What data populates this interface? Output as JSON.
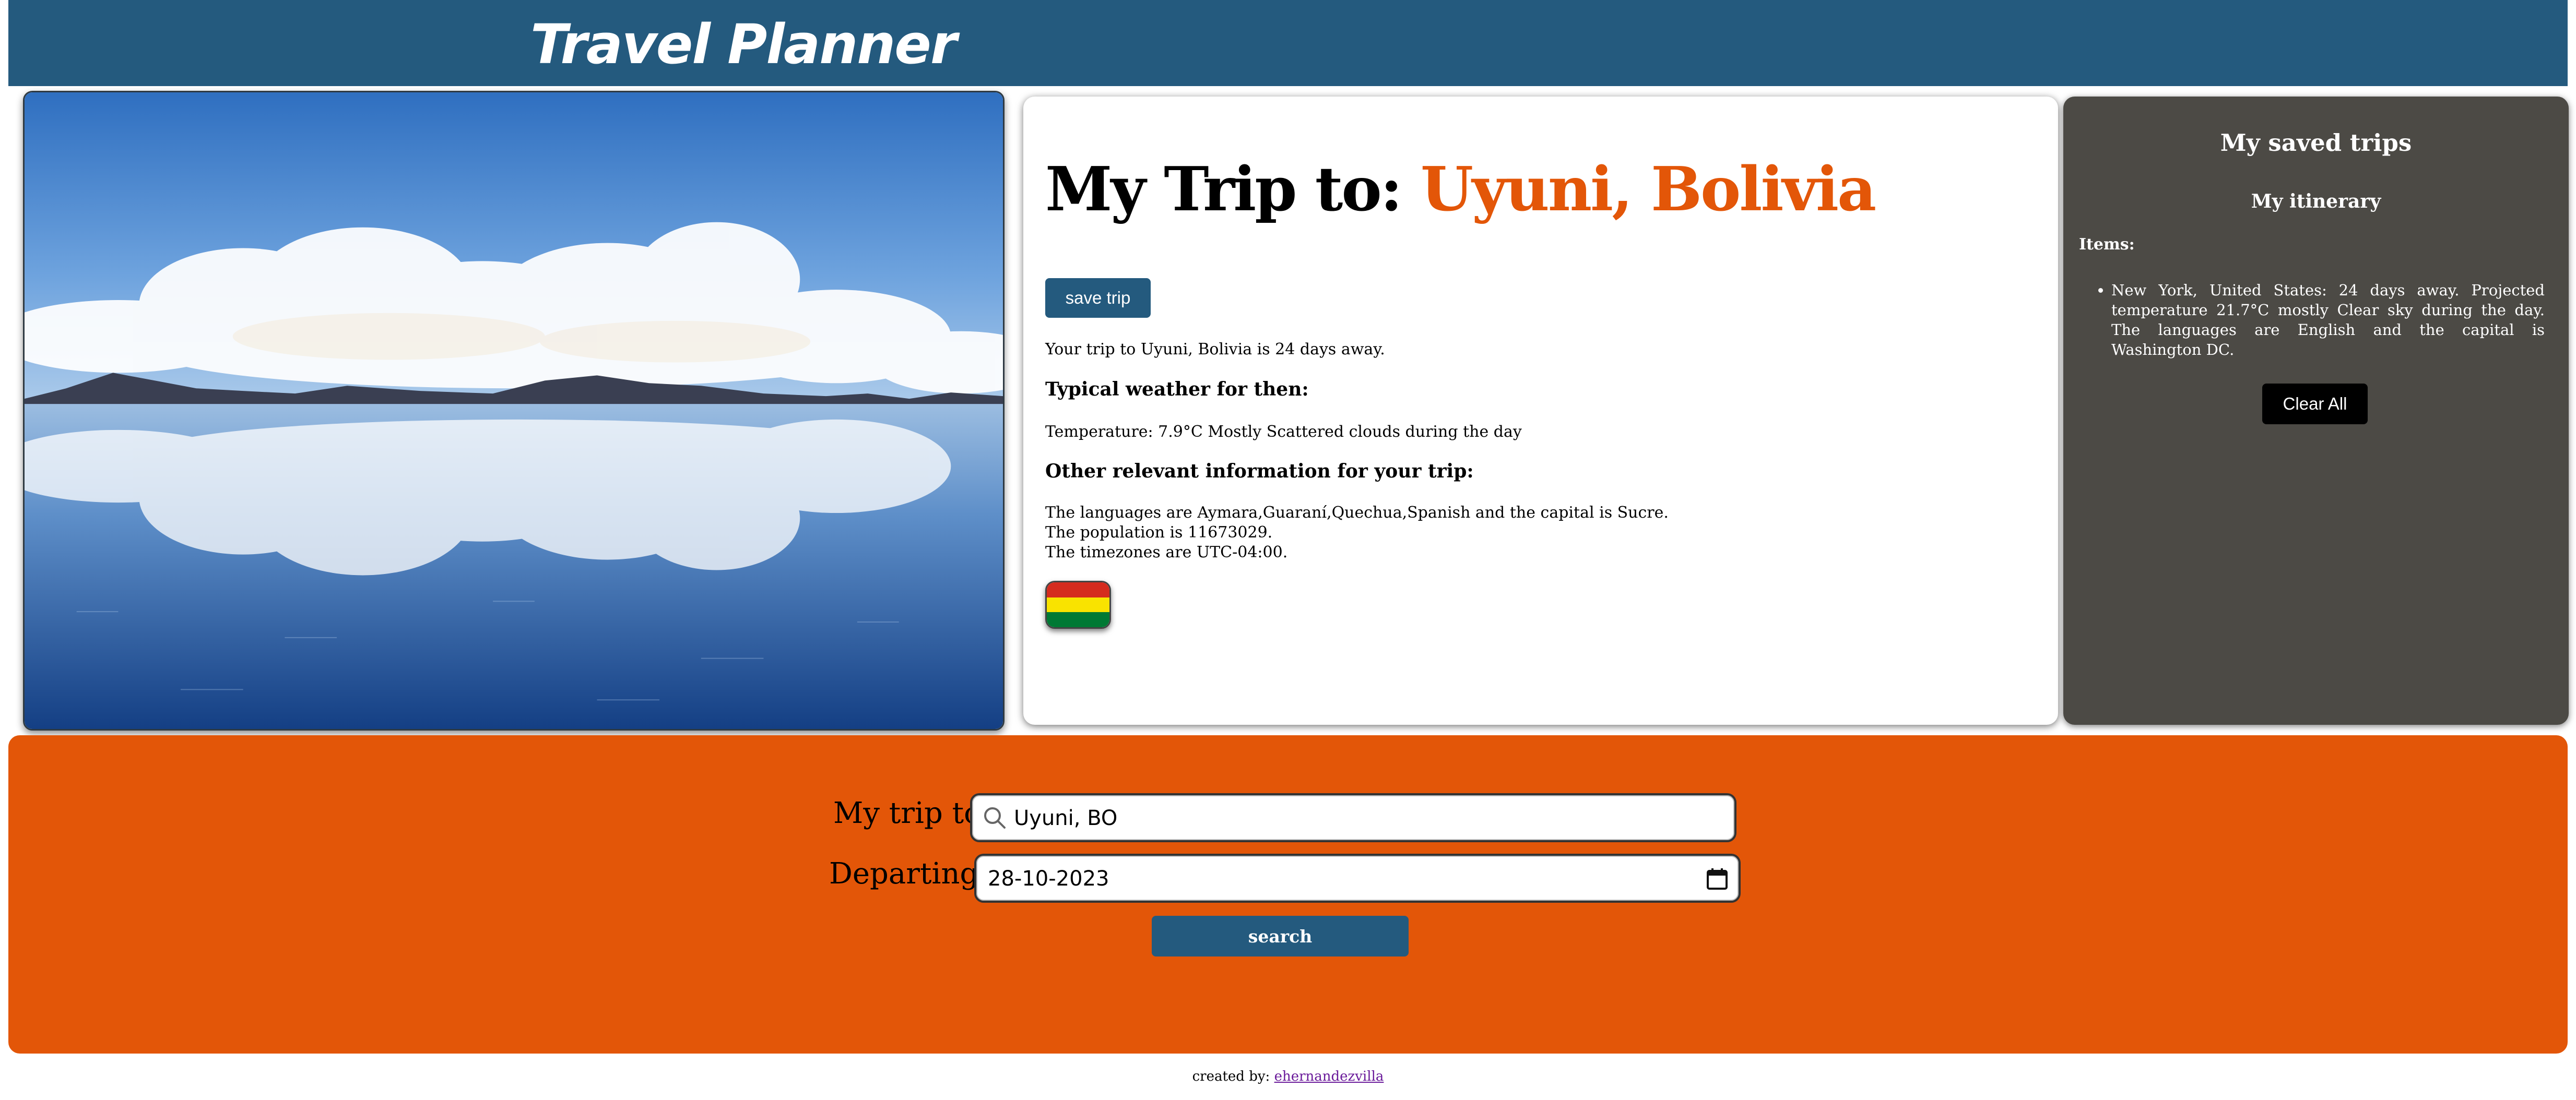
{
  "header": {
    "title": "Travel Planner"
  },
  "trip": {
    "heading_prefix": "My Trip to:",
    "destination": "Uyuni, Bolivia",
    "save_button": "save trip",
    "days_away": "Your trip to Uyuni, Bolivia is 24 days away.",
    "weather_heading": "Typical weather for then:",
    "weather": "Temperature: 7.9°C Mostly Scattered clouds during the day",
    "info_heading": "Other relevant information for your trip:",
    "languages": "The languages are Aymara,Guaraní,Quechua,Spanish and the capital is Sucre.",
    "population": "The population is 11673029.",
    "timezones": "The timezones are UTC-04:00.",
    "flag_colors": [
      "#d52b1e",
      "#f9e300",
      "#007934"
    ]
  },
  "saved": {
    "title": "My saved trips",
    "itinerary_title": "My itinerary",
    "items_label": "Items:",
    "items": [
      "New York, United States: 24 days away. Projected temperature 21.7°C mostly Clear sky during the day. The languages are English and the capital is Washington DC."
    ],
    "clear_button": "Clear All"
  },
  "search": {
    "destination_label": "My trip to:",
    "destination_value": "Uyuni, BO",
    "departing_label": "Departing:",
    "departing_value": "28-10-2023",
    "button": "search"
  },
  "footer": {
    "prefix": "created by:",
    "link": "ehernandezvilla"
  },
  "colors": {
    "header": "#245a7e",
    "accent": "#e35608",
    "saved_panel": "#4c4a45"
  }
}
